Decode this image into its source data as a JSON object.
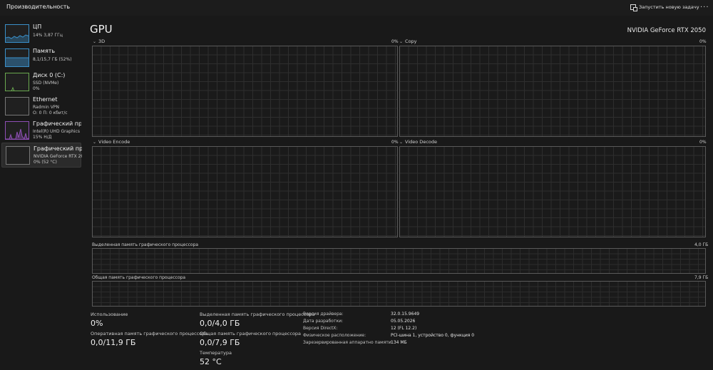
{
  "header": {
    "title": "Производительность",
    "run_task_label": "Запустить новую задачу",
    "more_label": "..."
  },
  "sidebar": {
    "items": [
      {
        "name": "ЦП",
        "line1": "14% 3,87 ГГц",
        "line2": ""
      },
      {
        "name": "Память",
        "line1": "8,1/15,7 ГБ (52%)",
        "line2": ""
      },
      {
        "name": "Диск 0 (C:)",
        "line1": "SSD (NVMe)",
        "line2": "0%"
      },
      {
        "name": "Ethernet",
        "line1": "Radmin VPN",
        "line2": "О: 0 П: 0 кбит/с"
      },
      {
        "name": "Графический про",
        "line1": "Intel(R) UHD Graphics",
        "line2": "15% Н/Д"
      },
      {
        "name": "Графический про",
        "line1": "NVIDIA GeForce RTX 2050",
        "line2": "0% (52 °C)"
      }
    ]
  },
  "main": {
    "title": "GPU",
    "model": "NVIDIA GeForce RTX 2050",
    "engines": [
      {
        "label": "3D",
        "percent": "0%"
      },
      {
        "label": "Copy",
        "percent": "0%"
      },
      {
        "label": "Video Encode",
        "percent": "0%"
      },
      {
        "label": "Video Decode",
        "percent": "0%"
      }
    ],
    "dedicated_graph": {
      "label": "Выделенная память графического процессора",
      "max": "4,0 ГБ"
    },
    "shared_graph": {
      "label": "Общая память графического процессора",
      "max": "7,9 ГБ"
    }
  },
  "stats": {
    "utilization": {
      "label": "Использование",
      "value": "0%"
    },
    "gpu_memory": {
      "label": "Оперативная память графического процессора",
      "value": "0,0/11,9 ГБ"
    },
    "dedicated_memory": {
      "label": "Выделенная память графического процессора",
      "value": "0,0/4,0 ГБ"
    },
    "shared_memory": {
      "label": "Общая память графического процессора",
      "value": "0,0/7,9 ГБ"
    },
    "temperature": {
      "label": "Температура",
      "value": "52 °C"
    },
    "details": [
      {
        "key": "Версия драйвера:",
        "value": "32.0.15.9649"
      },
      {
        "key": "Дата разработки:",
        "value": "05.05.2026"
      },
      {
        "key": "Версия DirectX:",
        "value": "12 (FL 12.2)"
      },
      {
        "key": "Физическое расположение:",
        "value": "PCI-шина 1, устройство 0, функция 0"
      },
      {
        "key": "Зарезервированная аппаратно памяти:",
        "value": "134 МБ"
      }
    ]
  },
  "colors": {
    "background": "#191919",
    "cpu_accent": "#3a8fc9",
    "disk_accent": "#6aa84f",
    "gpu_accent": "#8e4fb5",
    "graph_border": "#5a5a5a"
  }
}
